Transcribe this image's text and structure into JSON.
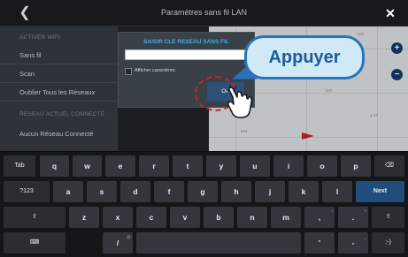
{
  "window": {
    "title": "Paramètres sans fil LAN",
    "back_icon": "chevron-left-icon",
    "close_icon": "close-icon"
  },
  "sidebar": {
    "heading1": "ACTIVER WIFI",
    "items": [
      {
        "label": "Sans fil"
      },
      {
        "label": "Scan"
      },
      {
        "label": "Oublier Tous les Réseaux"
      }
    ],
    "heading2": "RESEAU ACTUEL CONNECTÉ",
    "connected": "Aucun Réseau Connecté"
  },
  "dialog": {
    "title": "SAISIR CLE RESEAU SANS FIL",
    "input_value": "",
    "show_chars_label": "Afficher caractères",
    "show_chars_checked": false,
    "ok_label": "OK"
  },
  "callout": {
    "text": "Appuyer",
    "color_border": "#2a73b9",
    "color_fill": "#d1e9f6"
  },
  "map": {
    "depths": [
      "641",
      "547",
      "944",
      "4.17"
    ],
    "zoom_in": "+",
    "zoom_out": "−"
  },
  "keyboard": {
    "row1": [
      "Tab",
      "q",
      "w",
      "e",
      "r",
      "t",
      "y",
      "u",
      "i",
      "o",
      "p",
      "⌫"
    ],
    "row2": [
      "?123",
      "a",
      "s",
      "d",
      "f",
      "g",
      "h",
      "j",
      "k",
      "l",
      "Next"
    ],
    "row3": [
      "⇧",
      "z",
      "x",
      "c",
      "v",
      "b",
      "n",
      "m",
      ",",
      ".",
      "⇧"
    ],
    "row4": [
      "⌨",
      "/",
      "",
      "'",
      "-",
      ":-)"
    ],
    "row3_alts": [
      "!",
      "?"
    ],
    "row4_alts": [
      "@",
      "\"",
      "_"
    ]
  },
  "colors": {
    "accent": "#3bb0e8",
    "next_key": "#1f4e7c",
    "highlight": "#d0202a"
  }
}
